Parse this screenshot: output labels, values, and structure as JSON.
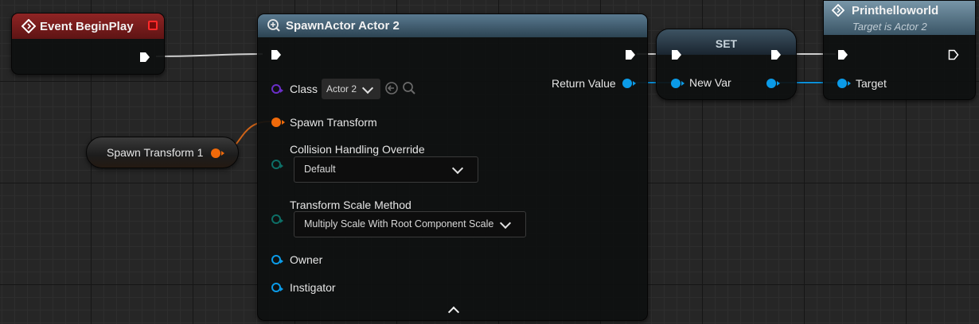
{
  "begin_play": {
    "title": "Event BeginPlay"
  },
  "spawn_transform_var": {
    "label": "Spawn Transform 1"
  },
  "spawn_actor": {
    "title": "SpawnActor Actor 2",
    "class_label": "Class",
    "class_value": "Actor 2",
    "return_value_label": "Return Value",
    "spawn_transform_label": "Spawn Transform",
    "collision_label": "Collision Handling Override",
    "collision_value": "Default",
    "scale_method_label": "Transform Scale Method",
    "scale_method_value": "Multiply Scale With Root Component Scale",
    "owner_label": "Owner",
    "instigator_label": "Instigator"
  },
  "set_node": {
    "title": "SET",
    "var_label": "New Var"
  },
  "print_node": {
    "title": "Printhelloworld",
    "subtitle": "Target is Actor 2",
    "target_label": "Target"
  },
  "colors": {
    "event_header": "#7a1c1c",
    "function_header": "#3d5a6e",
    "object_pin": "#0b9be8",
    "struct_pin": "#f06a0a",
    "class_pin": "#5c1fa8",
    "enum_pin": "#0d6e66",
    "exec_pin": "#ffffff"
  }
}
